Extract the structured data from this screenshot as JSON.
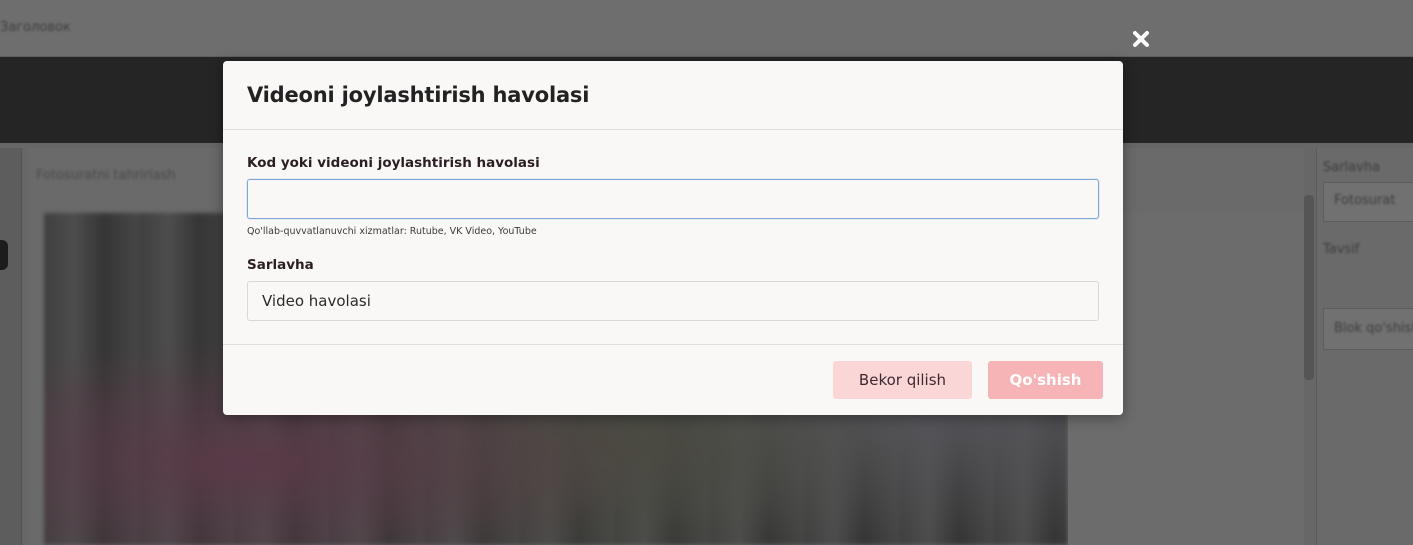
{
  "background": {
    "breadcrumb": "Заголовок",
    "editor_caption": "Fotosuratni tahrirlash",
    "right_panel_title": "Sarlavha",
    "right_panel_field": "Fotosurat",
    "right_panel_label": "Tavsif",
    "right_panel_item": "Blok qo'shish"
  },
  "dialog": {
    "title": "Videoni joylashtirish havolasi",
    "close_icon": "close-icon",
    "embed_field": {
      "label": "Kod yoki videoni joylashtirish havolasi",
      "value": "",
      "placeholder": "",
      "hint": "Qo'llab-quvvatlanuvchi xizmatlar: Rutube, VK Video, YouTube"
    },
    "title_field": {
      "label": "Sarlavha",
      "value": "Video havolasi"
    },
    "buttons": {
      "cancel": "Bekor qilish",
      "add": "Qo'shish"
    }
  },
  "colors": {
    "overlay": "#6b6b6b",
    "modal_bg": "#faf8f6",
    "cancel_bg": "#fbd6d6",
    "add_bg": "#f7b4b6",
    "focus_border": "#7ea7d6"
  }
}
